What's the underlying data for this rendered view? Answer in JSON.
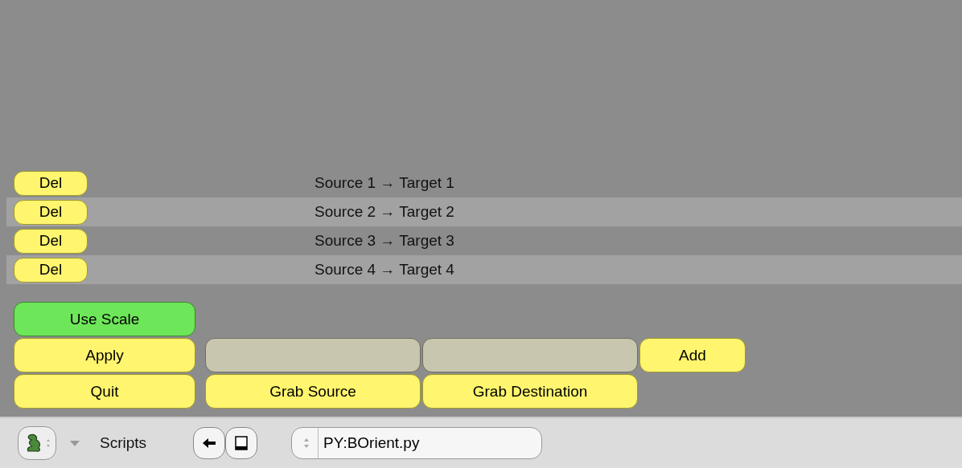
{
  "mappings": [
    {
      "delete_button": "Del",
      "label": "Source 1 → Target 1"
    },
    {
      "delete_button": "Del",
      "label": "Source 2 → Target 2"
    },
    {
      "delete_button": "Del",
      "label": "Source 3 → Target 3"
    },
    {
      "delete_button": "Del",
      "label": "Source 4 → Target 4"
    }
  ],
  "use_scale": {
    "label": "Use Scale",
    "on": true
  },
  "apply_button": "Apply",
  "quit_button": "Quit",
  "add_button": "Add",
  "grab_source_button": "Grab Source",
  "grab_destination_button": "Grab Destination",
  "header": {
    "menu_label": "Scripts",
    "script_name": "PY:BOrient.py"
  }
}
